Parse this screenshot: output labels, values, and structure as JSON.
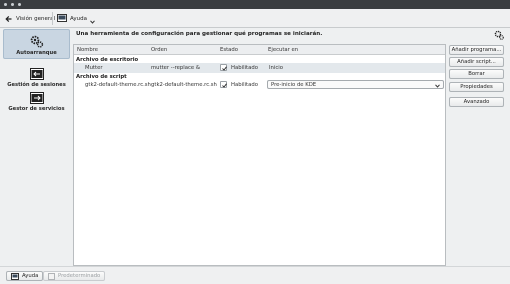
{
  "toolbar": {
    "overview_label": "Visión general",
    "help_label": "Ayuda"
  },
  "sidebar": {
    "items": [
      {
        "label": "Autoarranque",
        "icon": "gears-icon",
        "selected": true
      },
      {
        "label": "Gestión de sesiones",
        "icon": "session-icon",
        "selected": false
      },
      {
        "label": "Gestor de servicios",
        "icon": "services-icon",
        "selected": false
      }
    ]
  },
  "main": {
    "description": "Una herramienta de configuración para gestionar qué programas se iniciarán.",
    "table": {
      "columns": [
        "Nombre",
        "Orden",
        "Estado",
        "Ejecutar en"
      ],
      "groups": [
        {
          "label": "Archivo de escritorio",
          "rows": [
            {
              "name": "Mutter",
              "command": "mutter --replace &",
              "enabled": true,
              "status": "Habilitado",
              "run_on": "Inicio"
            }
          ]
        },
        {
          "label": "Archivo de script",
          "rows": [
            {
              "name": "gtk2-default-theme.rc.sh",
              "command": "gtk2-default-theme.rc.sh",
              "enabled": true,
              "status": "Habilitado",
              "run_on": "Pre-inicio de KDE"
            }
          ]
        }
      ]
    }
  },
  "actions": {
    "add_program": "Añadir programa...",
    "add_script": "Añadir script...",
    "remove": "Borrar",
    "properties": "Propiedades",
    "advanced": "Avanzado"
  },
  "bottom": {
    "help": "Ayuda",
    "defaults": "Predeterminado"
  },
  "colors": {
    "selection": "#c9d6e2",
    "titlebar": "#3a3d40"
  }
}
